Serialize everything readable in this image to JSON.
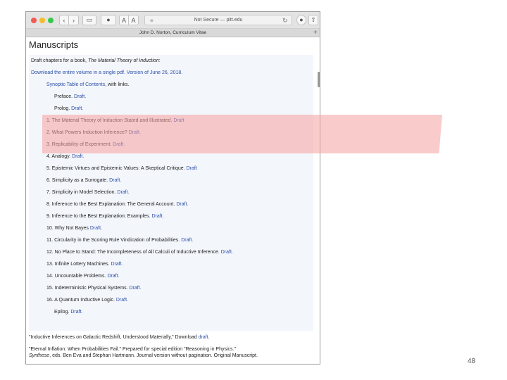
{
  "browser": {
    "address": "Not Secure — pitt.edu",
    "tab_title": "John D. Norton, Curriculum Vitae",
    "buttons": {
      "back": "‹",
      "forward": "›",
      "sidebar": "▭",
      "font_small": "A",
      "font_large": "A",
      "menu": "≡",
      "share": "⇪",
      "extension": "●",
      "new_tab": "+"
    }
  },
  "page": {
    "title": "Manuscripts",
    "intro": {
      "prefix": "Draft chapters for a book, ",
      "book": "The Material Theory of Induction",
      "suffix": ":"
    },
    "download": "Download the entire volume in a single pdf. Version of June 26, 2018.",
    "synoptic": {
      "link": "Synoptic Table of Contents",
      "rest": ", with links."
    },
    "chapters": [
      {
        "title": "Preface.",
        "draft": "Draft."
      },
      {
        "title": "Prolog.",
        "draft": "Draft."
      },
      {
        "title": "1. The Material Theory of Induction Stated and Illustrated.",
        "draft": "Draft"
      },
      {
        "title": "2. What Powers Induction Inference?",
        "draft": "Draft."
      },
      {
        "title": "3. Replicability of Experiment.",
        "draft": "Draft."
      },
      {
        "title": "4. Analogy.",
        "draft": "Draft."
      },
      {
        "title": "5. Epistemic Virtues and Epistemic Values: A Skeptical Critique.",
        "draft": "Draft"
      },
      {
        "title": "6. Simplicity as a Surrogate.",
        "draft": "Draft."
      },
      {
        "title": "7. Simplicity in Model Selection.",
        "draft": "Draft."
      },
      {
        "title": "8. Inference to the Best Explanation: The General Account.",
        "draft": "Draft."
      },
      {
        "title": "9. Inference to the Best Explanation: Examples.",
        "draft": "Draft."
      },
      {
        "title": "10. Why Not Bayes",
        "draft": "Draft."
      },
      {
        "title": "11. Circularity in the Scoring Rule Vindication of Probabilities.",
        "draft": "Draft."
      },
      {
        "title": "12. No Place to Stand: The Incompleteness of All Calculi of Inductive Inference.",
        "draft": "Draft."
      },
      {
        "title": "13. Infinite Lottery Machines.",
        "draft": "Draft."
      },
      {
        "title": "14. Uncountable Problems.",
        "draft": "Draft."
      },
      {
        "title": "15. Indeterministic Physical Systems.",
        "draft": "Draft."
      },
      {
        "title": "16. A Quantum Inductive Logic.",
        "draft": "Draft."
      },
      {
        "title": "Epilog.",
        "draft": "Draft."
      }
    ],
    "extra1": {
      "text": "\"Inductive Inferences on Galactic Redshift, Understood Materially,\" Download ",
      "link": "draft",
      "end": "."
    },
    "extra2": {
      "line1": "\"Eternal Inflation: When Probabilities Fail.\" Prepared for special edition \"Reasoning in Physics.\"",
      "journal": "Synthese",
      "line2": ", eds. Ben Eva and Stephan Hartmann. Journal version without pagination. Original Manuscript."
    }
  },
  "slide": {
    "page_number": "48"
  },
  "colors": {
    "link": "#2a4fa8",
    "highlight": "#f6a0a0",
    "box": "#f3f6fb"
  }
}
